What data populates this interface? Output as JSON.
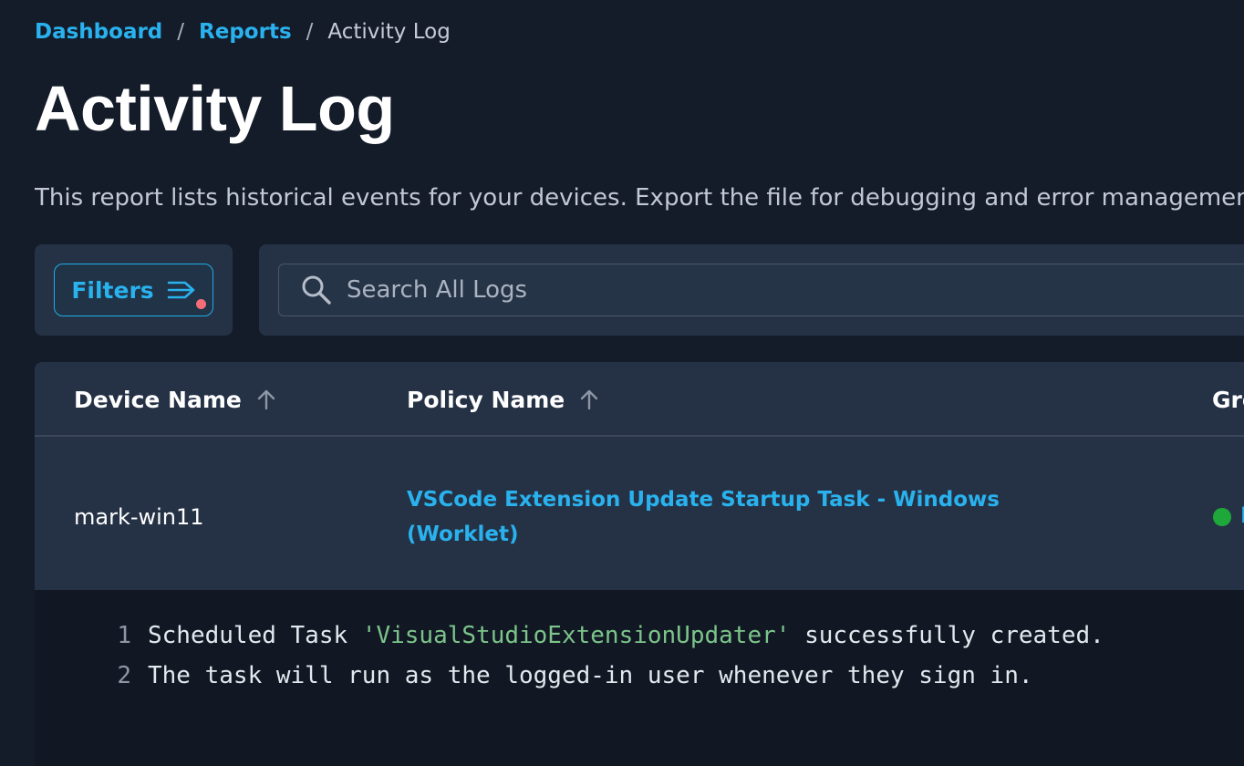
{
  "breadcrumb": {
    "items": [
      {
        "label": "Dashboard"
      },
      {
        "label": "Reports"
      }
    ],
    "separator": "/",
    "current": "Activity Log"
  },
  "page": {
    "title": "Activity Log",
    "description": "This report lists historical events for your devices. Export the file for debugging and error management."
  },
  "filters": {
    "label": "Filters",
    "icon": "filter-lines-arrow-icon",
    "active_indicator_color": "#f46d76"
  },
  "search": {
    "placeholder": "Search All Logs",
    "value": "",
    "icon": "search-icon"
  },
  "table": {
    "columns": [
      {
        "label": "Device Name",
        "sort": "ascending"
      },
      {
        "label": "Policy Name",
        "sort": "ascending"
      },
      {
        "label": "Gro"
      }
    ],
    "rows": [
      {
        "device": "mark-win11",
        "policy": "VSCode Extension Update Startup Task - Windows (Worklet)",
        "status_color": "#1fa83a",
        "status_label": "l"
      }
    ]
  },
  "log_output": {
    "lines": [
      {
        "number": "1",
        "before": "Scheduled Task ",
        "string": "'VisualStudioExtensionUpdater'",
        "after": " successfully created."
      },
      {
        "number": "2",
        "before": "The task will run as the logged-in user whenever they sign in.",
        "string": "",
        "after": ""
      }
    ]
  },
  "colors": {
    "background": "#141c2a",
    "card": "#253246",
    "accent": "#29b2ee",
    "code_background": "#111824",
    "code_string": "#7cc48a"
  }
}
